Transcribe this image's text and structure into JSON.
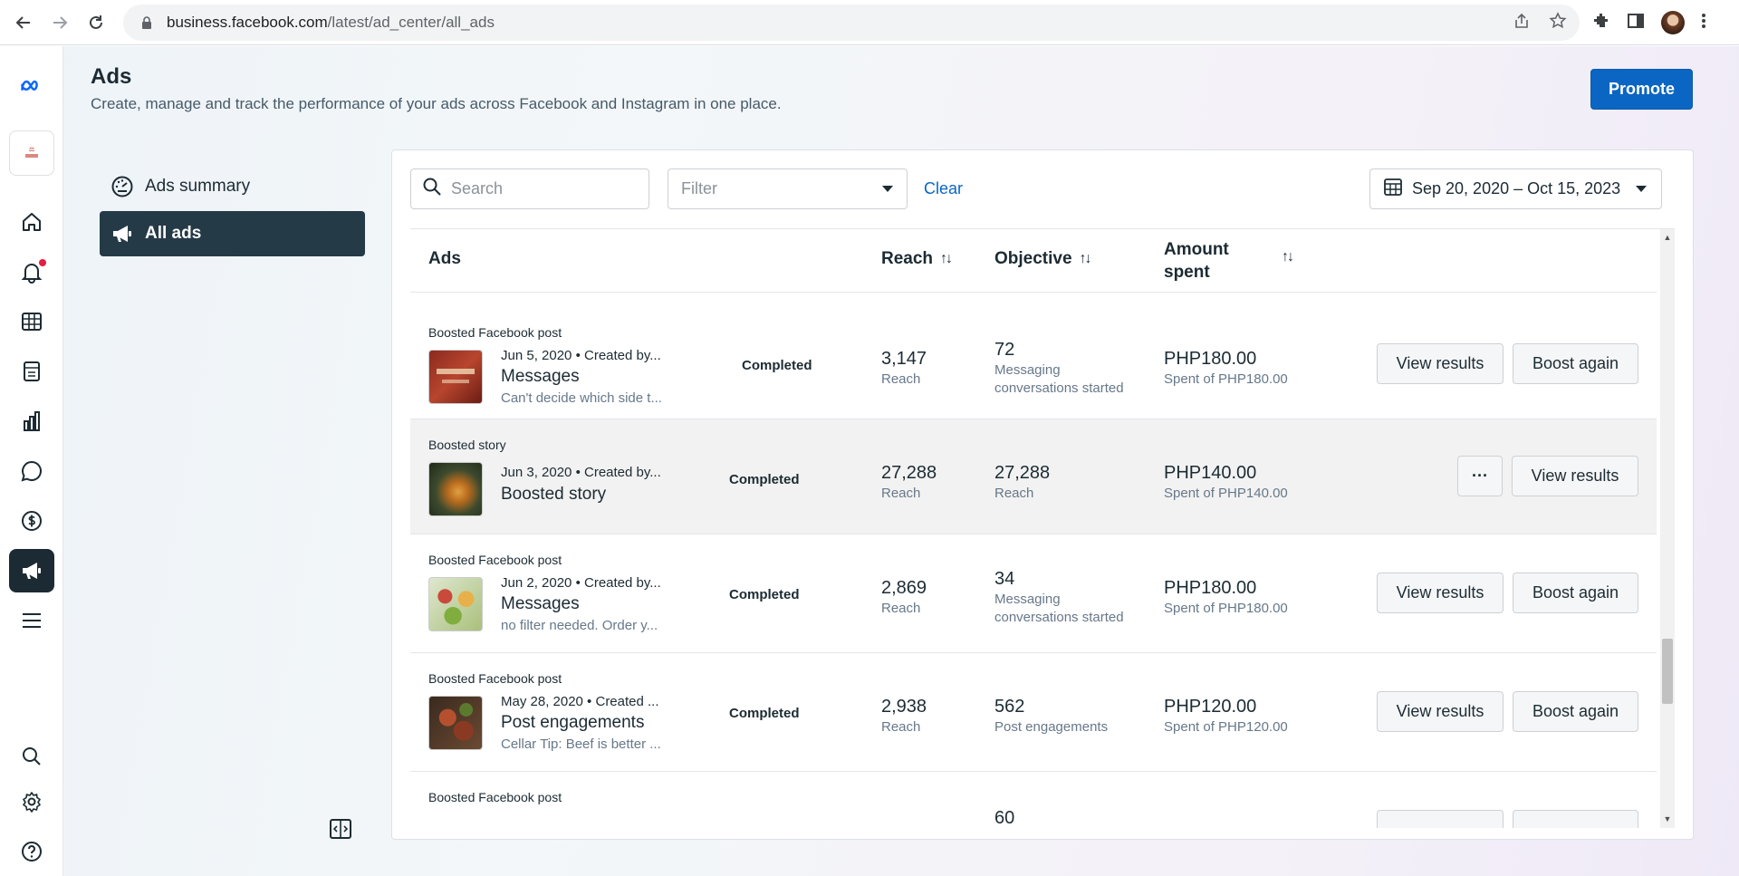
{
  "browser": {
    "url_host": "business.facebook.com",
    "url_path": "/latest/ad_center/all_ads"
  },
  "header": {
    "title": "Ads",
    "subtitle": "Create, manage and track the performance of your ads across Facebook and Instagram in one place.",
    "promote_label": "Promote"
  },
  "sidebar": {
    "items": [
      {
        "label": "Ads summary",
        "icon": "gauge-icon"
      },
      {
        "label": "All ads",
        "icon": "megaphone-icon"
      }
    ]
  },
  "rail": {
    "icons": [
      "meta-logo",
      "brand-thumbnail",
      "home-icon",
      "bell-icon",
      "table-icon",
      "pages-icon",
      "bar-chart-icon",
      "chat-icon",
      "dollar-icon",
      "megaphone-icon",
      "menu-icon",
      "search-icon",
      "gear-icon",
      "help-icon"
    ]
  },
  "toolbar": {
    "search_placeholder": "Search",
    "filter_placeholder": "Filter",
    "clear_label": "Clear",
    "date_range": "Sep 20, 2020 – Oct 15, 2023"
  },
  "table": {
    "headers": {
      "ads": "Ads",
      "reach": "Reach",
      "objective": "Objective",
      "amount_line1": "Amount",
      "amount_line2": "spent"
    },
    "rows": [
      {
        "type": "Boosted Facebook post",
        "meta": "Jun 5, 2020 • Created by...",
        "name": "Messages",
        "desc": "Can't decide which side t...",
        "status": "Completed",
        "reach": "3,147",
        "reach_sub": "Reach",
        "objective": "72",
        "objective_sub1": "Messaging",
        "objective_sub2": "conversations started",
        "amount": "PHP180.00",
        "amount_sub": "Spent of PHP180.00",
        "btn1": "View results",
        "btn2": "Boost again"
      },
      {
        "type": "Boosted story",
        "meta": "Jun 3, 2020 • Created by...",
        "name": "Boosted story",
        "desc": "",
        "status": "Completed",
        "reach": "27,288",
        "reach_sub": "Reach",
        "objective": "27,288",
        "objective_sub1": "Reach",
        "objective_sub2": "",
        "amount": "PHP140.00",
        "amount_sub": "Spent of PHP140.00",
        "btn1": "···",
        "btn2": "View results"
      },
      {
        "type": "Boosted Facebook post",
        "meta": "Jun 2, 2020 • Created by...",
        "name": "Messages",
        "desc": "no filter needed. Order y...",
        "status": "Completed",
        "reach": "2,869",
        "reach_sub": "Reach",
        "objective": "34",
        "objective_sub1": "Messaging",
        "objective_sub2": "conversations started",
        "amount": "PHP180.00",
        "amount_sub": "Spent of PHP180.00",
        "btn1": "View results",
        "btn2": "Boost again"
      },
      {
        "type": "Boosted Facebook post",
        "meta": "May 28, 2020 • Created ...",
        "name": "Post engagements",
        "desc": "Cellar Tip: Beef is better ...",
        "status": "Completed",
        "reach": "2,938",
        "reach_sub": "Reach",
        "objective": "562",
        "objective_sub1": "Post engagements",
        "objective_sub2": "",
        "amount": "PHP120.00",
        "amount_sub": "Spent of PHP120.00",
        "btn1": "View results",
        "btn2": "Boost again"
      },
      {
        "type": "Boosted Facebook post",
        "objective": "60"
      }
    ]
  },
  "colors": {
    "primary": "#0a66c2",
    "dark_nav": "#253a47",
    "status_green": "#31a24c",
    "notification": "#e41e3f"
  }
}
